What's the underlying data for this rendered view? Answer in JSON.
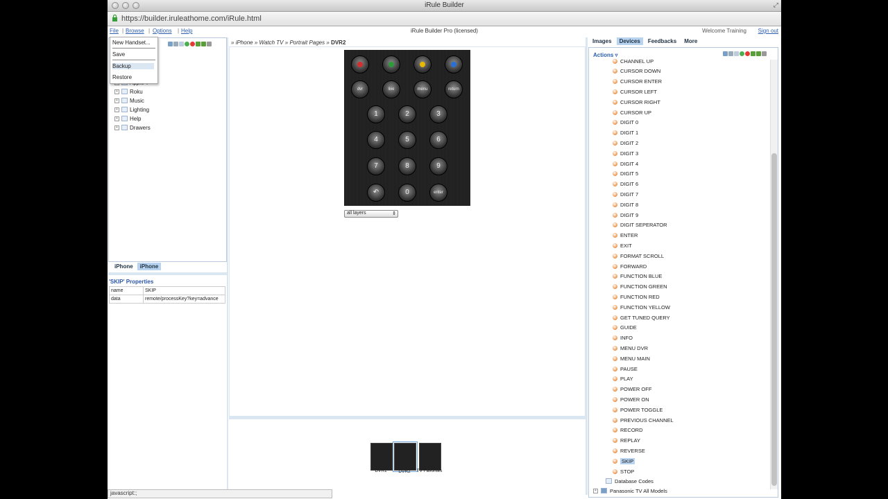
{
  "window": {
    "title": "iRule Builder"
  },
  "url": "https://builder.iruleathome.com/iRule.html",
  "menubar": {
    "file": "File",
    "browse": "Browse",
    "options": "Options",
    "help": "Help",
    "center_title": "iRule Builder Pro (licensed)",
    "welcome": "Welcome Training",
    "signout": "Sign out"
  },
  "file_menu": {
    "new_handset": "New Handset...",
    "save": "Save",
    "backup": "Backup",
    "restore": "Restore"
  },
  "tree": {
    "partial": "Apple T",
    "items": [
      "Roku",
      "Music",
      "Lighting",
      "Help",
      "Drawers"
    ]
  },
  "handset_tabs": [
    "iPhone",
    "iPhone"
  ],
  "properties": {
    "title": "'SKIP' Properties",
    "rows": [
      {
        "key": "name",
        "value": "SKIP"
      },
      {
        "key": "data",
        "value": "remote/processKey?key=advance"
      }
    ]
  },
  "breadcrumb": {
    "items": [
      "iPhone",
      "Watch TV",
      "Portrait Pages"
    ],
    "current": "DVR2",
    "sep": "»"
  },
  "keypad": {
    "top_labels": [
      "dvr",
      "live",
      "menu",
      "return"
    ],
    "digits": [
      "1",
      "2",
      "3",
      "4",
      "5",
      "6",
      "7",
      "8",
      "9"
    ],
    "zero": "0",
    "enter": "enter",
    "colors": [
      "#d32f2f",
      "#2e9b3a",
      "#e6b800",
      "#2a6fd6"
    ]
  },
  "layer_select": "all layers",
  "thumbnails": [
    "DVR1",
    "DVR2",
    "TV Favorites"
  ],
  "right_tabs": [
    "Images",
    "Devices",
    "Feedbacks",
    "More"
  ],
  "actions_label": "Actions ▿",
  "commands": [
    "CHANNEL UP",
    "CURSOR DOWN",
    "CURSOR ENTER",
    "CURSOR LEFT",
    "CURSOR RIGHT",
    "CURSOR UP",
    "DIGIT 0",
    "DIGIT 1",
    "DIGIT 2",
    "DIGIT 3",
    "DIGIT 4",
    "DIGIT 5",
    "DIGIT 6",
    "DIGIT 7",
    "DIGIT 8",
    "DIGIT 9",
    "DIGIT SEPERATOR",
    "ENTER",
    "EXIT",
    "FORMAT SCROLL",
    "FORWARD",
    "FUNCTION BLUE",
    "FUNCTION GREEN",
    "FUNCTION RED",
    "FUNCTION YELLOW",
    "GET TUNED QUERY",
    "GUIDE",
    "INFO",
    "MENU DVR",
    "MENU MAIN",
    "PAUSE",
    "PLAY",
    "POWER OFF",
    "POWER ON",
    "POWER TOGGLE",
    "PREVIOUS CHANNEL",
    "RECORD",
    "REPLAY",
    "REVERSE",
    "SKIP",
    "STOP"
  ],
  "selected_command": "SKIP",
  "database_codes": "Database Codes",
  "device_root": "Panasonic TV All Models",
  "status": "javascript:;"
}
